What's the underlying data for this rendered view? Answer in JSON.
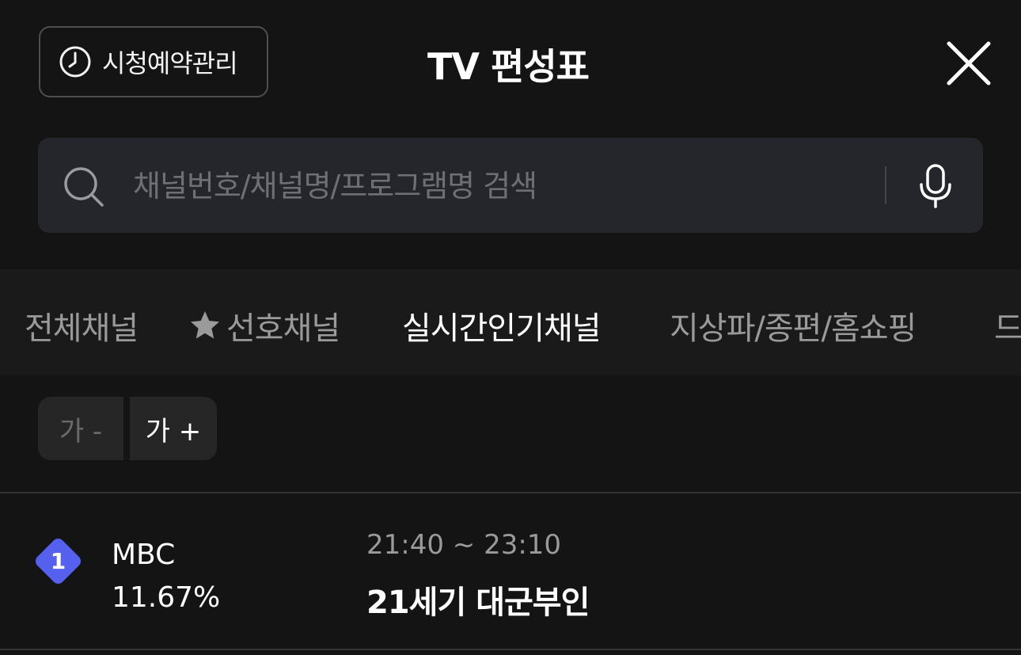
{
  "header": {
    "reserve_label": "시청예약관리",
    "title": "TV 편성표",
    "reserve_icon": "clock-icon",
    "close_icon": "close-icon"
  },
  "search": {
    "placeholder": "채널번호/채널명/프로그램명 검색",
    "value": "",
    "search_icon": "search-icon",
    "mic_icon": "mic-icon"
  },
  "tabs": [
    {
      "label": "전체채널",
      "active": false
    },
    {
      "label": "선호채널",
      "active": false,
      "icon": "star-icon"
    },
    {
      "label": "실시간인기채널",
      "active": true
    },
    {
      "label": "지상파/종편/홈쇼핑",
      "active": false
    },
    {
      "label": "드",
      "active": false
    }
  ],
  "font_size": {
    "decrease_label": "가 -",
    "increase_label": "가 +"
  },
  "channels": [
    {
      "rank": "1",
      "name": "MBC",
      "rating": "11.67%",
      "time": "21:40 ~ 23:10",
      "program": "21세기 대군부인"
    }
  ],
  "colors": {
    "background": "#141414",
    "search_bg": "#25262b",
    "tabs_bg": "#1a1a1a",
    "rank_badge": "#5560ee",
    "inactive_text": "#9a9a9a"
  }
}
